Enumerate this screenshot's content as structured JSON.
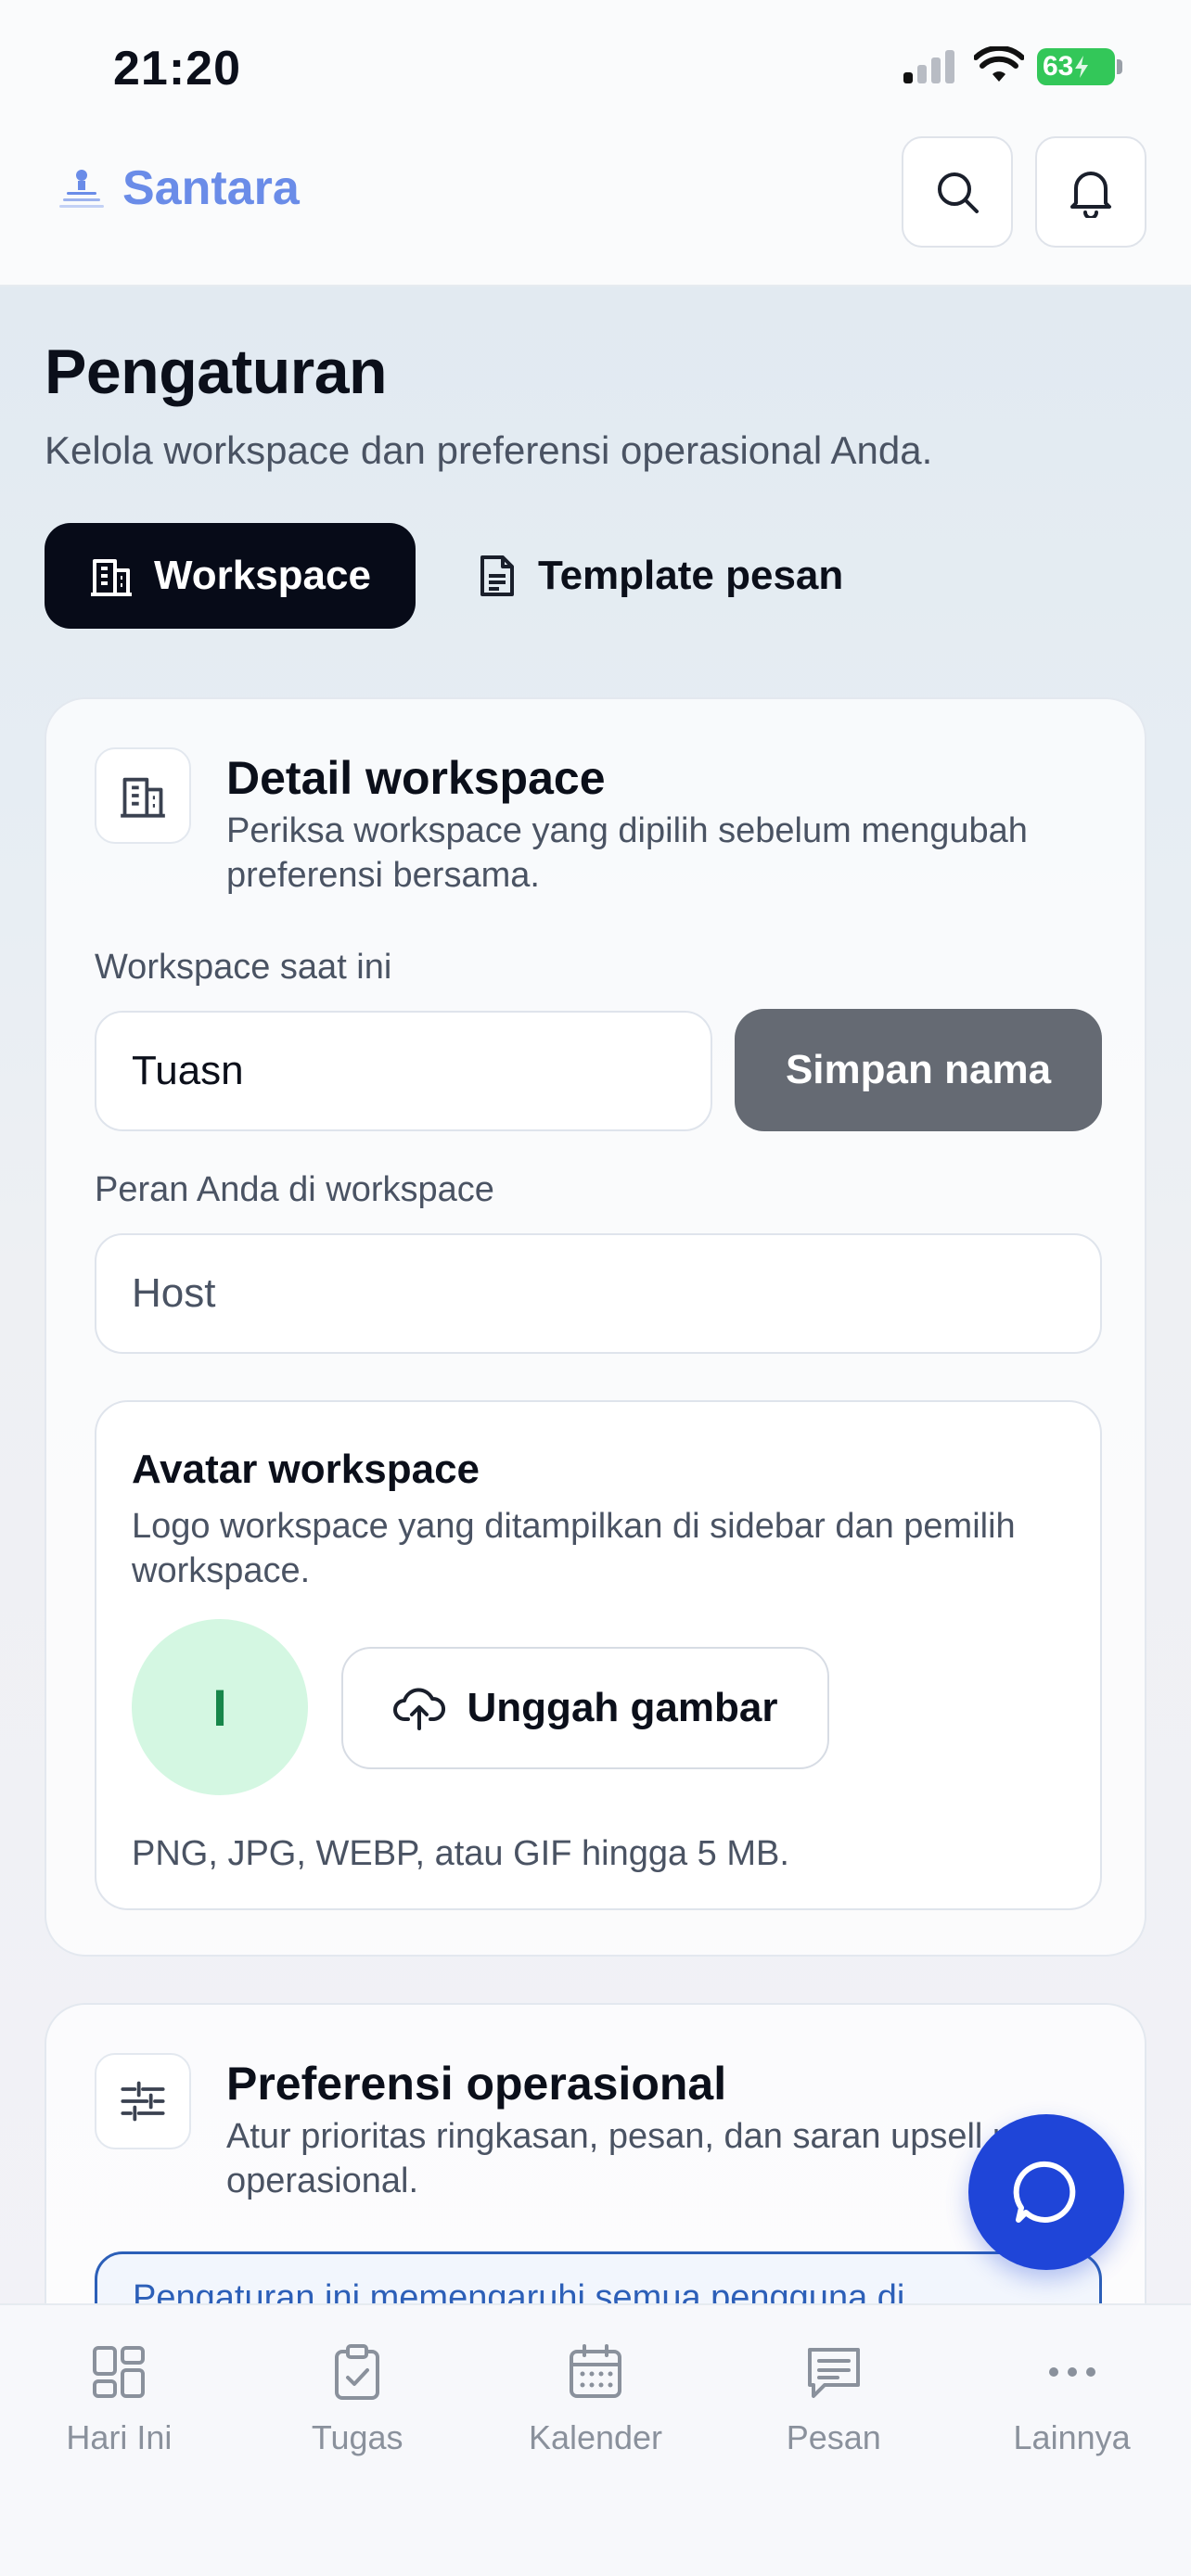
{
  "status": {
    "time": "21:20",
    "battery": "63"
  },
  "header": {
    "brand": "Santara"
  },
  "page": {
    "title": "Pengaturan",
    "subtitle": "Kelola workspace dan preferensi operasional Anda.",
    "tabs": [
      {
        "label": "Workspace",
        "active": true
      },
      {
        "label": "Template pesan",
        "active": false
      }
    ]
  },
  "workspace_card": {
    "title": "Detail workspace",
    "description": "Periksa workspace yang dipilih sebelum mengubah preferensi bersama.",
    "current_label": "Workspace saat ini",
    "current_value": "Tuasn",
    "save_label": "Simpan nama",
    "role_label": "Peran Anda di workspace",
    "role_value": "Host",
    "avatar": {
      "title": "Avatar workspace",
      "description": "Logo workspace yang ditampilkan di sidebar dan pemilih workspace.",
      "initial": "I",
      "upload_label": "Unggah gambar",
      "hint": "PNG, JPG, WEBP, atau GIF hingga 5 MB."
    }
  },
  "prefs_card": {
    "title": "Preferensi operasional",
    "description": "Atur prioritas ringkasan, pesan, dan saran upsell pusat operasional.",
    "notice": "Pengaturan ini memengaruhi semua pengguna di"
  },
  "nav": [
    {
      "label": "Hari Ini",
      "icon": "grid-icon"
    },
    {
      "label": "Tugas",
      "icon": "clipboard-check-icon"
    },
    {
      "label": "Kalender",
      "icon": "calendar-icon"
    },
    {
      "label": "Pesan",
      "icon": "message-icon"
    },
    {
      "label": "Lainnya",
      "icon": "more-icon"
    }
  ]
}
